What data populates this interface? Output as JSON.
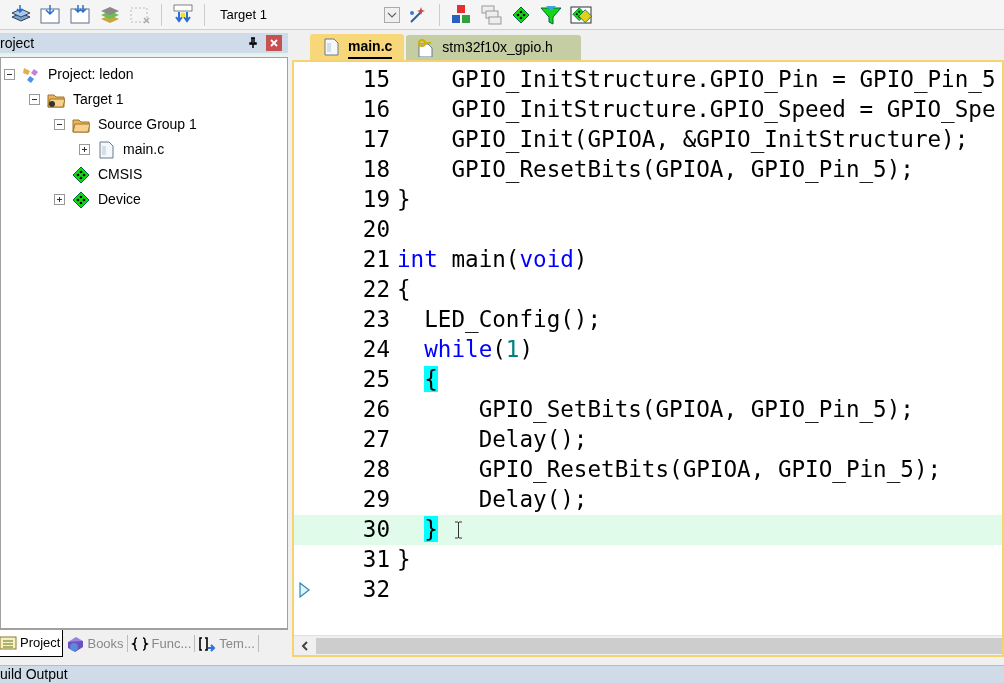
{
  "toolbar": {
    "target_select": {
      "value": "Target 1"
    }
  },
  "project_panel": {
    "title": "roject",
    "tree": [
      {
        "label": "Project: ledon",
        "kind": "project",
        "expanded": true,
        "children": [
          {
            "label": "Target 1",
            "kind": "target",
            "expanded": true,
            "children": [
              {
                "label": "Source Group 1",
                "kind": "folder",
                "expanded": true,
                "children": [
                  {
                    "label": "main.c",
                    "kind": "file",
                    "expanded": false
                  }
                ]
              },
              {
                "label": "CMSIS",
                "kind": "component"
              },
              {
                "label": "Device",
                "kind": "component",
                "expanded": false
              }
            ]
          }
        ]
      }
    ],
    "tabs": [
      {
        "label": "Project",
        "kind": "project",
        "selected": true
      },
      {
        "label": "Books",
        "kind": "books",
        "selected": false
      },
      {
        "label": "Func...",
        "kind": "functions",
        "selected": false
      },
      {
        "label": "Tem...",
        "kind": "templates",
        "selected": false
      }
    ]
  },
  "editor": {
    "tabs": [
      {
        "label": "main.c",
        "kind": "file",
        "selected": true
      },
      {
        "label": "stm32f10x_gpio.h",
        "kind": "header",
        "selected": false
      }
    ],
    "lines": [
      {
        "number": "15",
        "current": false,
        "segments": [
          {
            "kind": "plain",
            "text": "    GPIO_InitStructure.GPIO_Pin = GPIO_Pin_5"
          }
        ]
      },
      {
        "number": "16",
        "current": false,
        "segments": [
          {
            "kind": "plain",
            "text": "    GPIO_InitStructure.GPIO_Speed = GPIO_Spe"
          }
        ]
      },
      {
        "number": "17",
        "current": false,
        "segments": [
          {
            "kind": "plain",
            "text": "    GPIO_Init(GPIOA, &GPIO_InitStructure);"
          }
        ]
      },
      {
        "number": "18",
        "current": false,
        "segments": [
          {
            "kind": "plain",
            "text": "    GPIO_ResetBits(GPIOA, GPIO_Pin_5);"
          }
        ]
      },
      {
        "number": "19",
        "current": false,
        "segments": [
          {
            "kind": "plain",
            "text": "}"
          }
        ]
      },
      {
        "number": "20",
        "current": false
      },
      {
        "number": "21",
        "current": false,
        "segments": [
          {
            "kind": "keyword",
            "text": "int"
          },
          {
            "kind": "plain",
            "text": " main("
          },
          {
            "kind": "keyword",
            "text": "void"
          },
          {
            "kind": "plain",
            "text": ")"
          }
        ]
      },
      {
        "number": "22",
        "current": false,
        "segments": [
          {
            "kind": "plain",
            "text": "{"
          }
        ]
      },
      {
        "number": "23",
        "current": false,
        "segments": [
          {
            "kind": "plain",
            "text": "  LED_Config();"
          }
        ]
      },
      {
        "number": "24",
        "current": false,
        "segments": [
          {
            "kind": "keyword",
            "text": "  while"
          },
          {
            "kind": "plain",
            "text": "("
          },
          {
            "kind": "number",
            "text": "1"
          },
          {
            "kind": "plain",
            "text": ")"
          }
        ]
      },
      {
        "number": "25",
        "current": false,
        "segments": [
          {
            "kind": "brace_match",
            "text": "  {"
          }
        ]
      },
      {
        "number": "26",
        "current": false,
        "segments": [
          {
            "kind": "plain",
            "text": "      GPIO_SetBits(GPIOA, GPIO_Pin_5);"
          }
        ]
      },
      {
        "number": "27",
        "current": false,
        "segments": [
          {
            "kind": "plain",
            "text": "      Delay();"
          }
        ]
      },
      {
        "number": "28",
        "current": false,
        "segments": [
          {
            "kind": "plain",
            "text": "      GPIO_ResetBits(GPIOA, GPIO_Pin_5);"
          }
        ]
      },
      {
        "number": "29",
        "current": false,
        "segments": [
          {
            "kind": "plain",
            "text": "      Delay();"
          }
        ]
      },
      {
        "number": "30",
        "current": true,
        "segments": [
          {
            "kind": "brace_match",
            "text": "  }"
          }
        ]
      },
      {
        "number": "31",
        "current": false,
        "segments": [
          {
            "kind": "plain",
            "text": "}"
          }
        ]
      },
      {
        "number": "32",
        "current": false
      }
    ]
  },
  "build_output": {
    "title": "uild Output"
  }
}
